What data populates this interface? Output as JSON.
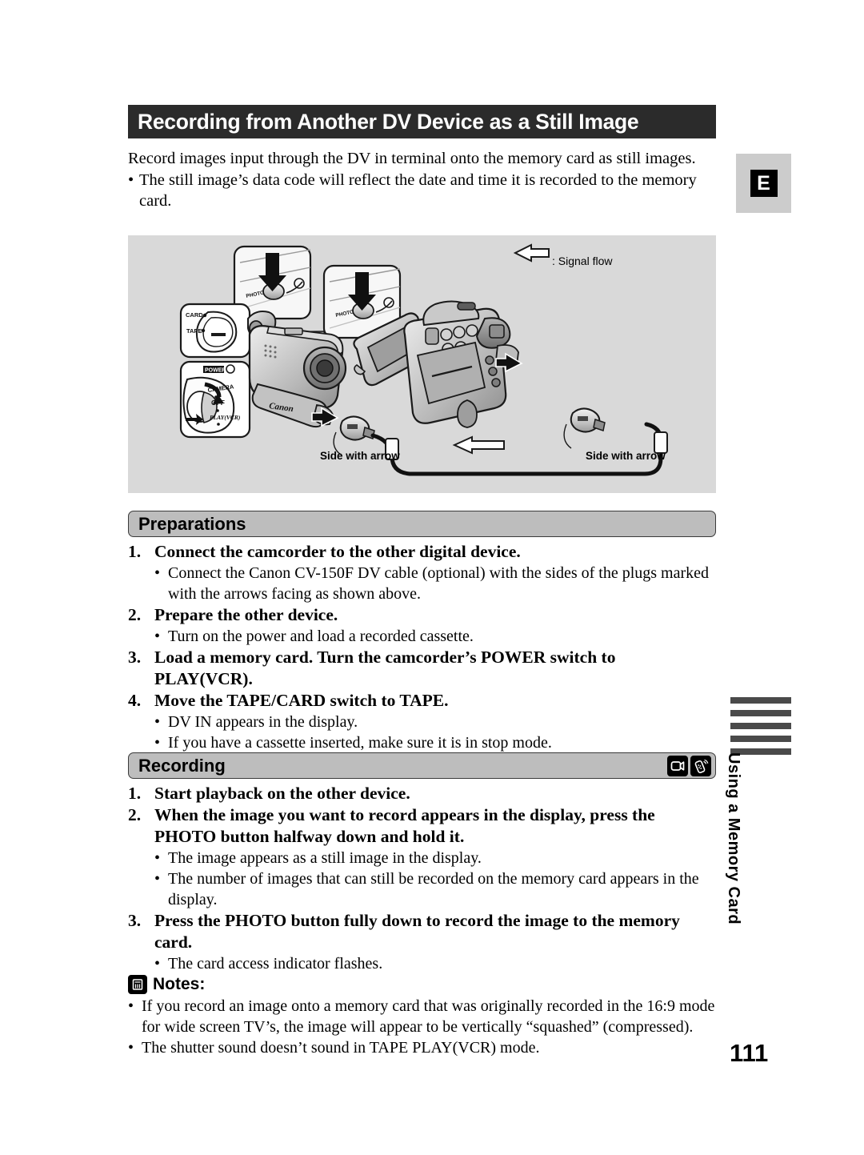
{
  "page": {
    "title": "Recording from Another DV Device as a Still Image",
    "language_tab": "E",
    "number": "111",
    "side_tab_text": "Using a Memory Card"
  },
  "intro": {
    "paragraph": "Record images input through the DV in terminal onto the memory card as still images.",
    "bullet_dot": "•",
    "bullet": "The still image’s data code will reflect the date and time it is recorded to the memory card."
  },
  "figure": {
    "signal_flow_label": ": Signal flow",
    "side_with_arrow_left": "Side with arrow",
    "side_with_arrow_right": "Side with arrow",
    "switch_callout": {
      "card": "CARD",
      "tape": "TAPE"
    },
    "power_callout": {
      "power": "POWER",
      "camera": "CAMERA",
      "off": "OFF",
      "playvcr": "PLAY(VCR)"
    },
    "brand": "Canon"
  },
  "preparations": {
    "header": "Preparations",
    "steps": [
      {
        "num": "1.",
        "text": "Connect the camcorder to the other digital device.",
        "subs": [
          "Connect the Canon CV-150F DV cable (optional) with the sides of the plugs marked with the arrows facing as shown above."
        ]
      },
      {
        "num": "2.",
        "text": "Prepare the other device.",
        "subs": [
          "Turn on the power and load a recorded cassette."
        ]
      },
      {
        "num": "3.",
        "text": "Load a memory card. Turn the camcorder’s POWER switch to PLAY(VCR).",
        "subs": []
      },
      {
        "num": "4.",
        "text": "Move the TAPE/CARD switch to TAPE.",
        "subs": [
          "DV IN appears in the display.",
          "If you have a cassette inserted, make sure it is in stop mode."
        ]
      }
    ]
  },
  "recording": {
    "header": "Recording",
    "icons": [
      "card-camcorder-icon",
      "remote-control-icon"
    ],
    "steps": [
      {
        "num": "1.",
        "text": "Start playback on the other device.",
        "subs": []
      },
      {
        "num": "2.",
        "text": "When the image you want to record appears in the display, press the PHOTO button halfway down and hold it.",
        "subs": [
          "The image appears as a still image in the display.",
          "The number of images that can still be recorded on the memory card appears in the display."
        ]
      },
      {
        "num": "3.",
        "text": "Press the PHOTO button fully down to record the image to the memory card.",
        "subs": [
          "The card access indicator flashes."
        ]
      }
    ]
  },
  "notes": {
    "label": "Notes:",
    "bullet_dot": "•",
    "items": [
      "If you record an image onto a memory card that was originally recorded in the 16:9 mode for wide screen TV’s, the image will appear to be vertically “squashed” (compressed).",
      "The shutter sound doesn’t sound in TAPE PLAY(VCR) mode."
    ]
  },
  "colors": {
    "title_bar": "#2b2b2b",
    "section_header": "#bdbdbd",
    "figure_background": "#d9d9d9",
    "side_bar": "#4a4a4a",
    "tab_background": "#cccccc"
  }
}
